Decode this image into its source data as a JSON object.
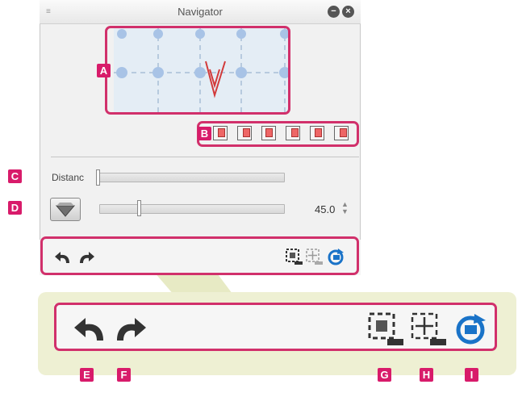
{
  "window": {
    "title": "Navigator",
    "menu_icon": "menu-icon",
    "minimize_icon": "minimize-icon",
    "close_icon": "close-icon"
  },
  "preview": {
    "model_icon": "3d-model-preview-icon"
  },
  "camera_presets": [
    {
      "name": "camera-preset-1-icon"
    },
    {
      "name": "camera-preset-2-icon"
    },
    {
      "name": "camera-preset-3-icon"
    },
    {
      "name": "camera-preset-4-icon"
    },
    {
      "name": "camera-preset-5-icon"
    },
    {
      "name": "camera-preset-6-icon"
    }
  ],
  "distance": {
    "label": "Distanc",
    "level": 0.0
  },
  "perspective": {
    "button_icon": "perspective-shape-icon",
    "level": 0.24,
    "value": "45.0",
    "spinner_icon": "spinner-icon"
  },
  "toolbar": {
    "undo_icon": "undo-icon",
    "redo_icon": "redo-icon",
    "fit_icon": "fit-to-selection-icon",
    "center_icon": "center-camera-icon",
    "reset_icon": "reset-camera-icon"
  },
  "callouts": {
    "A": "A",
    "B": "B",
    "C": "C",
    "D": "D",
    "E": "E",
    "F": "F",
    "G": "G",
    "H": "H",
    "I": "I"
  },
  "colors": {
    "callout": "#d81b6a",
    "frame": "#d1306b",
    "zoom_panel": "#eef0d3",
    "accent_blue": "#1a73c8"
  }
}
